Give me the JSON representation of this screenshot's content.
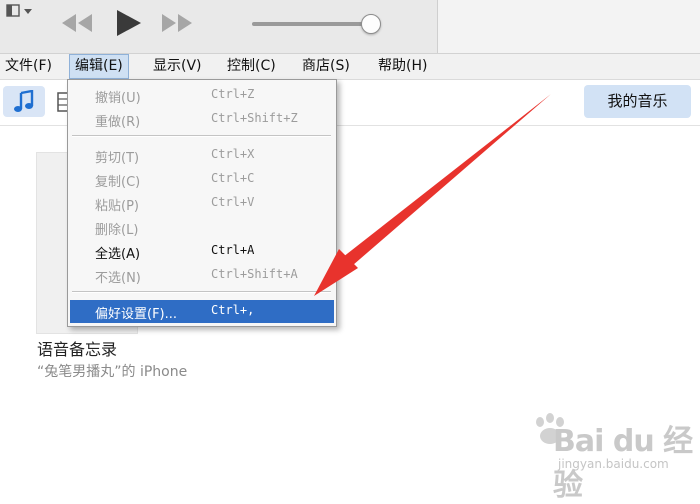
{
  "menubar": {
    "items": [
      {
        "label": "文件(F)"
      },
      {
        "label": "编辑(E)"
      },
      {
        "label": "显示(V)"
      },
      {
        "label": "控制(C)"
      },
      {
        "label": "商店(S)"
      },
      {
        "label": "帮助(H)"
      }
    ]
  },
  "toolbar": {
    "my_music_label": "我的音乐"
  },
  "edit_menu": {
    "items": [
      {
        "label": "撤销(U)",
        "shortcut": "Ctrl+Z",
        "enabled": false
      },
      {
        "label": "重做(R)",
        "shortcut": "Ctrl+Shift+Z",
        "enabled": false
      },
      {
        "label": "剪切(T)",
        "shortcut": "Ctrl+X",
        "enabled": false
      },
      {
        "label": "复制(C)",
        "shortcut": "Ctrl+C",
        "enabled": false
      },
      {
        "label": "粘贴(P)",
        "shortcut": "Ctrl+V",
        "enabled": false
      },
      {
        "label": "删除(L)",
        "shortcut": "",
        "enabled": false
      },
      {
        "label": "全选(A)",
        "shortcut": "Ctrl+A",
        "enabled": true
      },
      {
        "label": "不选(N)",
        "shortcut": "Ctrl+Shift+A",
        "enabled": false
      },
      {
        "label": "偏好设置(F)...",
        "shortcut": "Ctrl+,",
        "enabled": true,
        "highlighted": true
      }
    ]
  },
  "content": {
    "item_title": "语音备忘录",
    "item_subtitle": "“兔笔男播丸”的 iPhone"
  },
  "volume_level": 0.95,
  "watermark": {
    "brand": "Bai du 经验",
    "url": "jingyan.baidu.com"
  },
  "colors": {
    "menu_highlight": "#2f6dc5",
    "annotation_arrow": "#e8332d",
    "accent_button": "#d2e2f5"
  },
  "icons": [
    "window-menu-icon",
    "previous-track-icon",
    "play-icon",
    "next-track-icon",
    "music-note-icon",
    "movie-film-icon"
  ]
}
